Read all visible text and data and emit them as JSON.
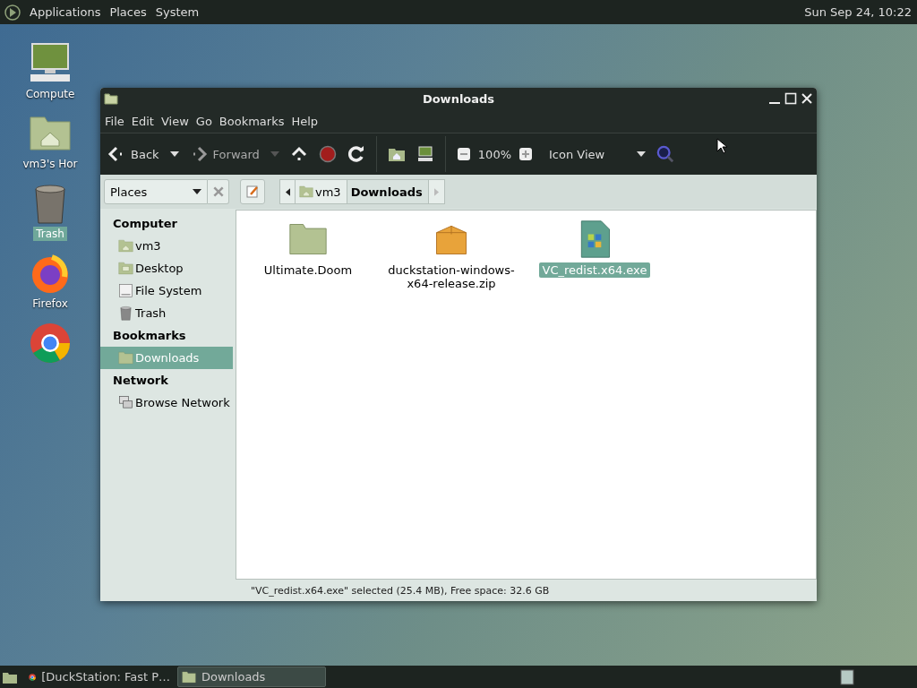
{
  "top_panel": {
    "menus": [
      "Applications",
      "Places",
      "System"
    ],
    "clock": "Sun Sep 24, 10:22"
  },
  "desktop_icons": [
    {
      "kind": "computer",
      "label": "Compute",
      "selected": false
    },
    {
      "kind": "home",
      "label": "vm3's Hor",
      "selected": false
    },
    {
      "kind": "trash",
      "label": "Trash",
      "selected": true
    },
    {
      "kind": "firefox",
      "label": "Firefox",
      "selected": false
    },
    {
      "kind": "chrome",
      "selected": false
    }
  ],
  "window": {
    "title": "Downloads",
    "menu": [
      "File",
      "Edit",
      "View",
      "Go",
      "Bookmarks",
      "Help"
    ],
    "toolbar": {
      "back": "Back",
      "forward": "Forward",
      "zoom": "100%",
      "view": "Icon View"
    },
    "location": {
      "places": "Places",
      "path": [
        {
          "label": "vm3",
          "selected": false
        },
        {
          "label": "Downloads",
          "selected": true
        }
      ]
    },
    "sidebar": [
      {
        "heading": "Computer",
        "items": [
          {
            "kind": "home",
            "label": "vm3",
            "selected": false
          },
          {
            "kind": "desktop",
            "label": "Desktop",
            "selected": false
          },
          {
            "kind": "drive",
            "label": "File System",
            "selected": false
          },
          {
            "kind": "trash",
            "label": "Trash",
            "selected": false
          }
        ]
      },
      {
        "heading": "Bookmarks",
        "items": [
          {
            "kind": "folder",
            "label": "Downloads",
            "selected": true
          }
        ]
      },
      {
        "heading": "Network",
        "items": [
          {
            "kind": "network",
            "label": "Browse Network",
            "selected": false
          }
        ]
      }
    ],
    "files": [
      {
        "kind": "folder",
        "name": "Ultimate.Doom",
        "selected": false
      },
      {
        "kind": "archive",
        "name": "duckstation-windows-x64-release.zip",
        "selected": false
      },
      {
        "kind": "exe",
        "name": "VC_redist.x64.exe",
        "selected": true
      }
    ],
    "status": "\"VC_redist.x64.exe\" selected (25.4 MB), Free space: 32.6 GB"
  },
  "taskbar": {
    "tasks": [
      {
        "kind": "chrome",
        "label": "[DuckStation: Fast P…",
        "selected": false
      },
      {
        "kind": "folder",
        "label": "Downloads",
        "selected": true
      }
    ]
  }
}
